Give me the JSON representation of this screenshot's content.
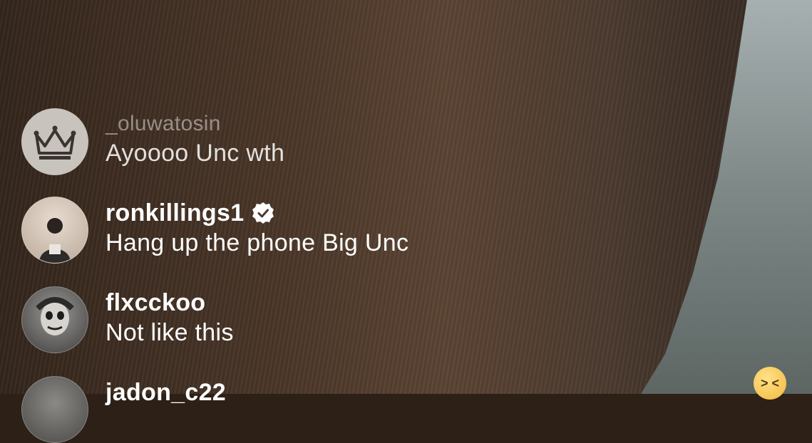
{
  "comments": [
    {
      "username": "_oluwatosin",
      "message": "Ayoooo Unc wth",
      "avatar": "crown-icon",
      "verified": false
    },
    {
      "username": "ronkillings1",
      "message": "Hang up the phone Big Unc",
      "avatar": "user-photo",
      "verified": true
    },
    {
      "username": "flxcckoo",
      "message": "Not like this",
      "avatar": "user-photo",
      "verified": false
    },
    {
      "username": "jadon_c22",
      "message": "",
      "avatar": "user-photo",
      "verified": false
    }
  ],
  "reaction": {
    "icon": "laughing-emoji-icon",
    "glyph": ">  <"
  }
}
